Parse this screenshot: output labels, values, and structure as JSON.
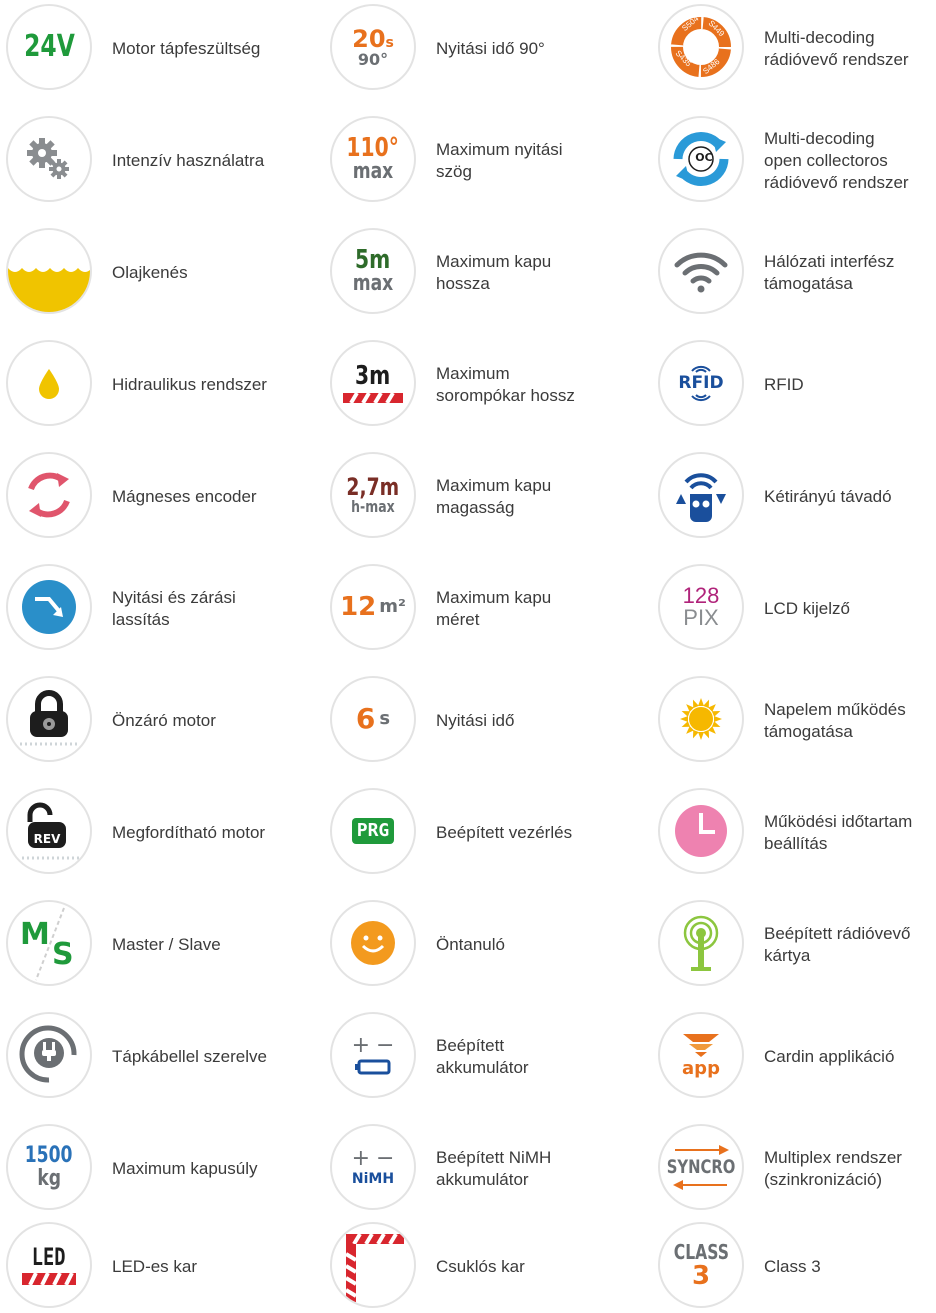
{
  "colors": {
    "green": "#1f9a3b",
    "orange": "#e8711d",
    "grey": "#6b6f73",
    "red": "#d8262e",
    "yellow": "#f0c400",
    "blue": "#2a8fc9",
    "pink": "#e0556c"
  },
  "columns": [
    {
      "items": [
        {
          "icon": "voltage-24v-icon",
          "label": "Motor tápfeszültség",
          "glyph": [
            "24V"
          ]
        },
        {
          "icon": "gears-icon",
          "label": "Intenzív használatra",
          "glyph": []
        },
        {
          "icon": "oil-bath-icon",
          "label": "Olajkenés",
          "glyph": []
        },
        {
          "icon": "oil-drop-icon",
          "label": "Hidraulikus rendszer",
          "glyph": []
        },
        {
          "icon": "magnetic-encoder-icon",
          "label": "Mágneses encoder",
          "glyph": []
        },
        {
          "icon": "slowdown-arrow-icon",
          "label": "Nyitási és zárási\nlassítás",
          "glyph": []
        },
        {
          "icon": "self-locking-motor-icon",
          "label": "Önzáró motor",
          "glyph": []
        },
        {
          "icon": "reversible-motor-icon",
          "label": "Megfordítható motor",
          "glyph": [
            "REV"
          ]
        },
        {
          "icon": "master-slave-icon",
          "label": "Master / Slave",
          "glyph": [
            "M",
            "S"
          ]
        },
        {
          "icon": "power-plug-icon",
          "label": "Tápkábellel szerelve",
          "glyph": []
        },
        {
          "icon": "max-weight-icon",
          "label": "Maximum kapusúly",
          "glyph": [
            "1500",
            "kg"
          ]
        },
        {
          "icon": "led-arm-icon",
          "label": "LED-es kar",
          "glyph": [
            "LED"
          ]
        }
      ]
    },
    {
      "items": [
        {
          "icon": "opening-time-90-icon",
          "label": "Nyitási idő 90°",
          "glyph": [
            "20",
            "s",
            "90°"
          ]
        },
        {
          "icon": "max-angle-icon",
          "label": "Maximum nyitási\nszög",
          "glyph": [
            "110°",
            "max"
          ]
        },
        {
          "icon": "max-gate-length-icon",
          "label": "Maximum kapu\nhossza",
          "glyph": [
            "5m",
            "max"
          ]
        },
        {
          "icon": "barrier-arm-length-icon",
          "label": "Maximum\nsorompókar hossz",
          "glyph": [
            "3m"
          ]
        },
        {
          "icon": "max-gate-height-icon",
          "label": "Maximum kapu\nmagasság",
          "glyph": [
            "2,7m",
            "h-max"
          ]
        },
        {
          "icon": "max-gate-area-icon",
          "label": "Maximum kapu\nméret",
          "glyph": [
            "12",
            "m²"
          ]
        },
        {
          "icon": "opening-time-icon",
          "label": "Nyitási idő",
          "glyph": [
            "6",
            "s"
          ]
        },
        {
          "icon": "built-in-controller-icon",
          "label": "Beépített vezérlés",
          "glyph": [
            "PRG"
          ]
        },
        {
          "icon": "self-learning-smiley-icon",
          "label": "Öntanuló",
          "glyph": []
        },
        {
          "icon": "battery-icon",
          "label": "Beépített\nakkumulátor",
          "glyph": [
            "+",
            "−"
          ]
        },
        {
          "icon": "nimh-battery-icon",
          "label": "Beépített NiMH\nakkumulátor",
          "glyph": [
            "+",
            "−",
            "NiMH"
          ]
        },
        {
          "icon": "articulated-arm-icon",
          "label": "Csuklós kar",
          "glyph": []
        }
      ]
    },
    {
      "items": [
        {
          "icon": "multi-decoding-icon",
          "label": "Multi-decoding\nrádióvevő rendszer",
          "glyph": [
            "S504",
            "S449",
            "S486",
            "S435"
          ]
        },
        {
          "icon": "open-collector-icon",
          "label": "Multi-decoding\nopen collectoros\nrádióvevő rendszer",
          "glyph": [
            "OC"
          ]
        },
        {
          "icon": "wifi-icon",
          "label": "Hálózati interfész\ntámogatása",
          "glyph": []
        },
        {
          "icon": "rfid-icon",
          "label": "RFID",
          "glyph": [
            "RFID"
          ]
        },
        {
          "icon": "bidirectional-remote-icon",
          "label": "Kétirányú távadó",
          "glyph": []
        },
        {
          "icon": "lcd-display-icon",
          "label": "LCD kijelző",
          "glyph": [
            "128",
            "PIX"
          ]
        },
        {
          "icon": "solar-sun-icon",
          "label": "Napelem működés\ntámogatása",
          "glyph": []
        },
        {
          "icon": "clock-icon",
          "label": "Működési időtartam\nbeállítás",
          "glyph": []
        },
        {
          "icon": "radio-receiver-antenna-icon",
          "label": "Beépített rádióvevő\nkártya",
          "glyph": []
        },
        {
          "icon": "cardin-app-icon",
          "label": "Cardin applikáció",
          "glyph": [
            "app"
          ]
        },
        {
          "icon": "syncro-icon",
          "label": "Multiplex rendszer\n(szinkronizáció)",
          "glyph": [
            "SYNCRO"
          ]
        },
        {
          "icon": "class-3-icon",
          "label": "Class 3",
          "glyph": [
            "CLASS",
            "3"
          ]
        }
      ]
    }
  ]
}
